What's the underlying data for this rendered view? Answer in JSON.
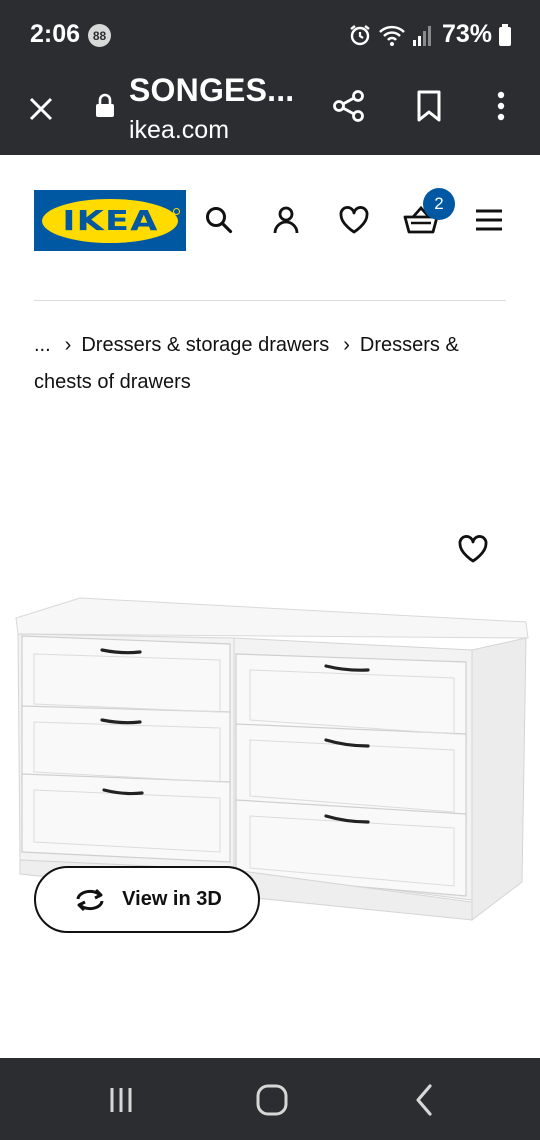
{
  "status_bar": {
    "time": "2:06",
    "notification_count": "88",
    "battery": "73%",
    "icons": [
      "alarm-icon",
      "wifi-icon",
      "signal-icon",
      "battery-icon"
    ]
  },
  "browser": {
    "title": "SONGES...",
    "domain": "ikea.com",
    "icons": [
      "close-icon",
      "lock-icon",
      "share-icon",
      "bookmark-icon",
      "more-icon"
    ]
  },
  "header": {
    "logo_text": "IKEA",
    "cart_count": "2",
    "icons": [
      "search-icon",
      "account-icon",
      "heart-icon",
      "basket-icon",
      "menu-icon"
    ],
    "colors": {
      "brand_blue": "#0058a3",
      "brand_yellow": "#ffdb00"
    }
  },
  "breadcrumb": {
    "items": [
      "...",
      "Dressers & storage drawers",
      "Dressers & chests of drawers"
    ],
    "separator": "›"
  },
  "product": {
    "view3d_label": "View in 3D",
    "icons": [
      "heart-icon",
      "rotate-3d-icon"
    ]
  },
  "nav_bar": {
    "icons": [
      "recents-icon",
      "home-icon",
      "back-icon"
    ]
  }
}
